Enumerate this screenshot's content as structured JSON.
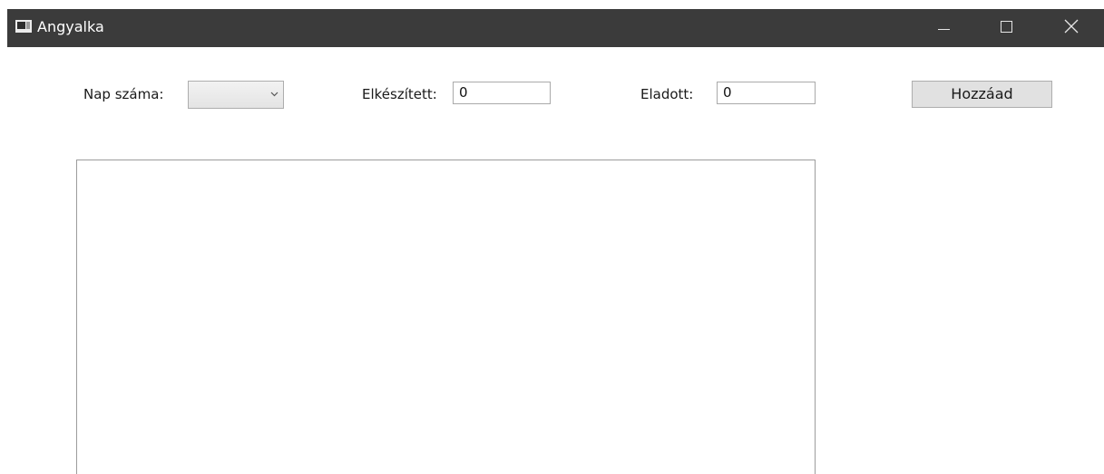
{
  "window": {
    "title": "Angyalka",
    "icon": "app-window-icon",
    "controls": {
      "minimize": "minimize-icon",
      "maximize": "maximize-icon",
      "close": "close-icon"
    }
  },
  "form": {
    "nap_label": "Nap száma:",
    "nap_value": "",
    "elkeszitett_label": "Elkészített:",
    "elkeszitett_value": "0",
    "eladott_label": "Eladott:",
    "eladott_value": "0",
    "add_button_label": "Hozzáad"
  },
  "list": {
    "items": []
  },
  "colors": {
    "titlebar": "#3b3b3b",
    "button": "#e1e1e1",
    "border": "#adadad"
  }
}
